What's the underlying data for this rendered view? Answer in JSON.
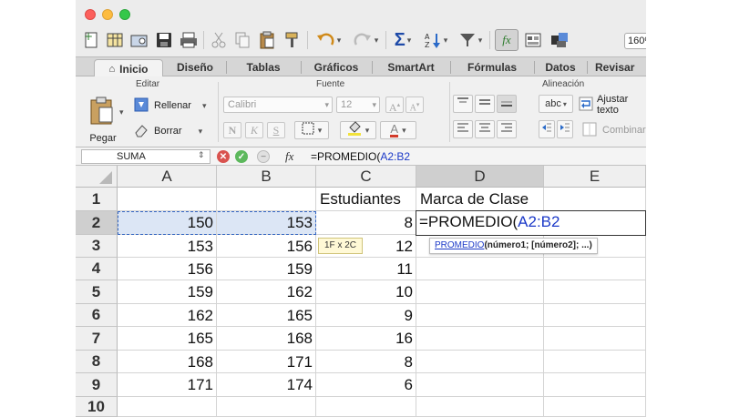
{
  "toolbar": {
    "zoom": "160%"
  },
  "tabs": {
    "inicio": "Inicio",
    "diseno": "Diseño",
    "tablas": "Tablas",
    "graficos": "Gráficos",
    "smartart": "SmartArt",
    "formulas": "Fórmulas",
    "datos": "Datos",
    "revisar": "Revisar"
  },
  "ribbon": {
    "editar_title": "Editar",
    "fuente_title": "Fuente",
    "alineacion_title": "Alineación",
    "pegar": "Pegar",
    "rellenar": "Rellenar",
    "borrar": "Borrar",
    "font_name": "Calibri",
    "font_size": "12",
    "bold": "N",
    "italic": "K",
    "underline": "S",
    "abc": "abc",
    "ajustar": "Ajustar texto",
    "combinar": "Combinar"
  },
  "formula_bar": {
    "name_box": "SUMA",
    "fx": "fx",
    "formula_prefix": "=PROMEDIO(",
    "formula_ref": "A2:B2"
  },
  "sheet": {
    "columns": [
      "A",
      "B",
      "C",
      "D",
      "E"
    ],
    "rows": [
      "1",
      "2",
      "3",
      "4",
      "5",
      "6",
      "7",
      "8",
      "9",
      "10"
    ],
    "C1": "Estudiantes",
    "D1": "Marca de Clase",
    "colA": [
      "",
      "150",
      "153",
      "156",
      "159",
      "162",
      "165",
      "168",
      "171"
    ],
    "colB": [
      "",
      "153",
      "156",
      "159",
      "162",
      "165",
      "168",
      "171",
      "174"
    ],
    "colC": [
      "",
      "8",
      "12",
      "11",
      "10",
      "9",
      "16",
      "8",
      "6"
    ],
    "edit_prefix": "=PROMEDIO(",
    "edit_ref": "A2:B2",
    "size_tip": "1F x 2C",
    "hint_fn": "PROMEDIO",
    "hint_args": "(número1; [número2]; ...)"
  },
  "colors": {
    "accent_ref": "#1b39c8",
    "selection": "#dce6f5",
    "tab_bar": "#d6d6d6"
  }
}
